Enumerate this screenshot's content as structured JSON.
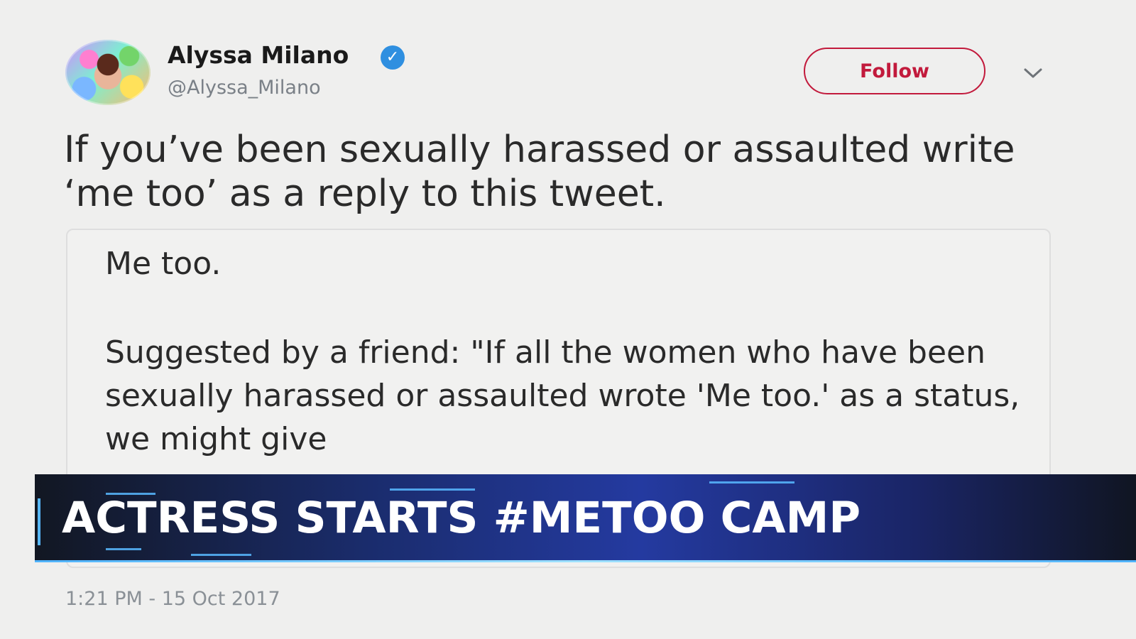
{
  "author": {
    "name": "Alyssa Milano",
    "handle": "@Alyssa_Milano",
    "verified": true
  },
  "actions": {
    "follow_label": "Follow"
  },
  "icons": {
    "verified": "verified-badge-icon",
    "menu": "chevron-down-icon",
    "avatar": "profile-avatar"
  },
  "tweet": {
    "text": "If you’ve been sexually harassed or assaulted write ‘me too’ as a reply to this tweet.",
    "quote_line1": "Me too.",
    "quote_line2": "Suggested by a friend: \"If all the women who have been sexually harassed or assaulted wrote 'Me too.' as a status, we might give",
    "timestamp": "1:21 PM - 15 Oct 2017"
  },
  "broadcast": {
    "headline": "ACTRESS STARTS #METOO CAMP"
  },
  "colors": {
    "follow_accent": "#c21a3c",
    "verified_blue": "#2f8fe0",
    "banner_blue": "#243aa0"
  }
}
